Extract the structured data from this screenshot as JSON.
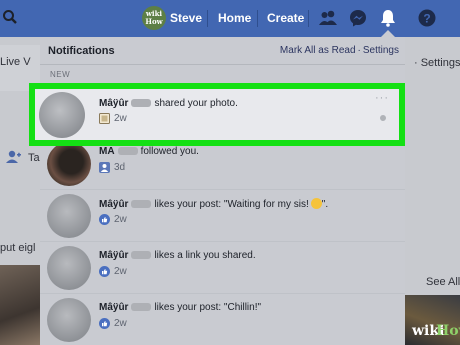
{
  "topbar": {
    "profile_badge": "wiki How",
    "profile_name": "Steve",
    "home_label": "Home",
    "create_label": "Create",
    "icons": [
      "search-icon",
      "friend-requests-icon",
      "messenger-icon",
      "notifications-bell-icon",
      "help-icon"
    ]
  },
  "background": {
    "left_texts": [
      "Live V",
      "Ta",
      "put eigl"
    ],
    "right_texts": [
      "· Settings",
      "See All"
    ]
  },
  "notifications": {
    "title": "Notifications",
    "mark_all_read": "Mark All as Read",
    "separator": "·",
    "settings": "Settings",
    "section_new": "NEW",
    "items": [
      {
        "name": "Mâÿûr",
        "text": "shared your photo.",
        "time": "2w",
        "icon": "photo-icon",
        "highlighted": true
      },
      {
        "name": "MA",
        "text": "followed you.",
        "time": "3d",
        "icon": "follow-icon"
      },
      {
        "name": "Mâÿûr",
        "text": "likes your post: \"Waiting for my sis!",
        "text_end": "\".",
        "time": "2w",
        "icon": "like-icon"
      },
      {
        "name": "Mâÿûr",
        "text": "likes a link you shared.",
        "time": "2w",
        "icon": "like-icon"
      },
      {
        "name": "Mâÿûr",
        "text": "likes your post: \"Chillin!\"",
        "time": "2w",
        "icon": "like-icon"
      }
    ]
  },
  "watermark": {
    "wiki": "wiki",
    "how": "How"
  },
  "colors": {
    "topbar": "#4267b2",
    "highlight": "#14e014",
    "like": "#4a6fc0"
  }
}
